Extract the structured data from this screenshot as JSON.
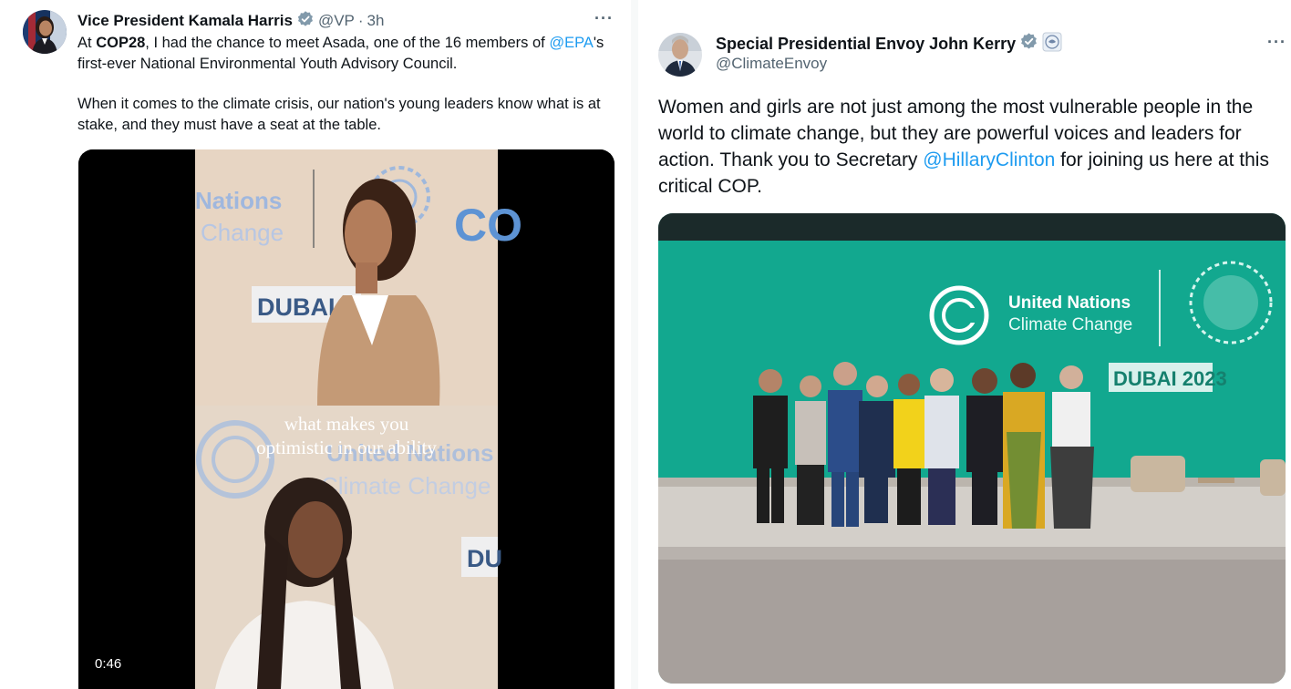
{
  "left_tweet": {
    "display_name": "Vice President Kamala Harris",
    "handle": "@VP",
    "separator": "·",
    "time": "3h",
    "more_icon": "···",
    "text_prefix": "At ",
    "text_bold": "COP28",
    "text_after_bold": ", I had the chance to meet Asada, one of the 16 members of",
    "text_mention": "@EPA",
    "text_after_mention": "'s first-ever National Environmental Youth Advisory Council.",
    "paragraph2": "When it comes to the climate crisis, our nation's young leaders know what is at stake, and they must have a seat at the table.",
    "video": {
      "backdrop_top_line1": "Nations",
      "backdrop_top_line2": "Change",
      "backdrop_top_cop": "CO",
      "backdrop_top_dubai": "DUBAI 202",
      "caption_line1": "what makes you",
      "caption_line2": "optimistic in our ability",
      "backdrop_bottom_line1": "United Nations",
      "backdrop_bottom_line2": "Climate Change",
      "backdrop_bottom_dubai": "DU",
      "duration": "0:46"
    }
  },
  "right_tweet": {
    "display_name": "Special Presidential Envoy John Kerry",
    "handle": "@ClimateEnvoy",
    "more_icon": "···",
    "text_before_mention": "Women and girls are not just among the most vulnerable people in the world to climate change, but they are powerful voices and leaders for action. Thank you to Secretary ",
    "text_mention": "@HillaryClinton",
    "text_after_mention": " for joining us here at this critical COP.",
    "photo": {
      "sign_line1": "United Nations",
      "sign_line2": "Climate Change",
      "sign_dubai": "DUBAI 2023"
    }
  },
  "colors": {
    "link": "#1d9bf0",
    "verified": "#829aab",
    "stage_teal": "#10a58c",
    "backdrop_beige": "#e9d7c4",
    "un_blue": "#4f8fd3"
  }
}
